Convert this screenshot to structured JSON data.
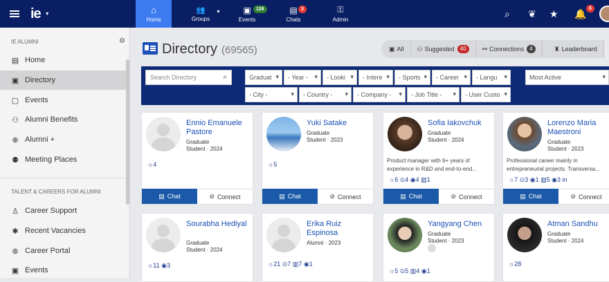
{
  "topbar": {
    "logo": "ie",
    "nav": [
      {
        "label": "Home",
        "icon": "home-icon"
      },
      {
        "label": "Groups",
        "icon": "groups-icon"
      },
      {
        "label": "Events",
        "icon": "calendar-icon",
        "badge": "126"
      },
      {
        "label": "Chats",
        "icon": "chat-icon",
        "badge": "3"
      },
      {
        "label": "Admin",
        "icon": "key-icon"
      }
    ],
    "notifications": "6"
  },
  "sidebar": {
    "section1": "IE ALUMNI",
    "items": [
      {
        "label": "Home",
        "icon": "card-icon"
      },
      {
        "label": "Directory",
        "icon": "id-card-icon"
      },
      {
        "label": "Events",
        "icon": "calendar-icon"
      },
      {
        "label": "Alumni Benefits",
        "icon": "users-plus-icon"
      },
      {
        "label": "Alumni +",
        "icon": "plus-circle-icon"
      },
      {
        "label": "Meeting Places",
        "icon": "group-icon"
      }
    ],
    "section2": "TALENT & CAREERS FOR ALUMNI",
    "items2": [
      {
        "label": "Career Support",
        "icon": "person-icon"
      },
      {
        "label": "Recent Vacancies",
        "icon": "star-icon"
      },
      {
        "label": "Career Portal",
        "icon": "globe-icon"
      },
      {
        "label": "Events",
        "icon": "calendar-plus-icon"
      }
    ]
  },
  "directory": {
    "title": "Directory",
    "count": "(69565)",
    "tabs": [
      {
        "label": "All"
      },
      {
        "label": "Suggested",
        "count": "40"
      },
      {
        "label": "Connections",
        "count": "4"
      },
      {
        "label": "Leaderboard"
      }
    ]
  },
  "filters": {
    "search_placeholder": "Search Directory",
    "row1": [
      "Graduat",
      "- Year -",
      "- Looki",
      "- Intere",
      "- Sports",
      "- Career",
      "- Langu"
    ],
    "sort": "Most Active",
    "row2": [
      "- City -",
      "- Country -",
      "- Company -",
      "- Job Title -",
      "- User Custo"
    ]
  },
  "cards": [
    {
      "name": "Ennio Emanuele Pastore",
      "role": "Graduate",
      "role2": "Student · 2024",
      "bio": "",
      "stats": "☼4"
    },
    {
      "name": "Yuki Satake",
      "role": "Graduate",
      "role2": "Student · 2023",
      "bio": "",
      "stats": "☼5"
    },
    {
      "name": "Sofia Iakovchuk",
      "role": "Graduate",
      "role2": "Student · 2024",
      "bio": "Product manager with 6+ years of experience in R&D and end-to-end...",
      "stats": "☼6 ⊙4 ◉4 ▥1"
    },
    {
      "name": "Lorenzo Maria Maestroni",
      "role": "Graduate",
      "role2": "Student · 2023",
      "bio": "Professional career mainly in entrepreneurial projects. Transversa...",
      "stats": "☼7 ⊙3 ◉1 ▥5 ◉3 in"
    },
    {
      "name": "Sourabha Hediyal",
      "role": "Graduate",
      "role2": "Student · 2024",
      "bio": "",
      "stats": "☼11 ◉3"
    },
    {
      "name": "Erika Ruiz Espinosa",
      "role": "Alumni · 2023",
      "role2": "",
      "bio": "",
      "stats": "☼21 ⊙7 ▥7 ◉1"
    },
    {
      "name": "Yangyang Chen",
      "role": "Graduate",
      "role2": "Student · 2023",
      "bio": "",
      "stats": "☼5 ⊙5 ▥4 ◉1"
    },
    {
      "name": "Atman Sandhu",
      "role": "Graduate",
      "role2": "Student · 2024",
      "bio": "",
      "stats": "☼28"
    }
  ],
  "buttons": {
    "chat": "Chat",
    "connect": "Connect"
  }
}
